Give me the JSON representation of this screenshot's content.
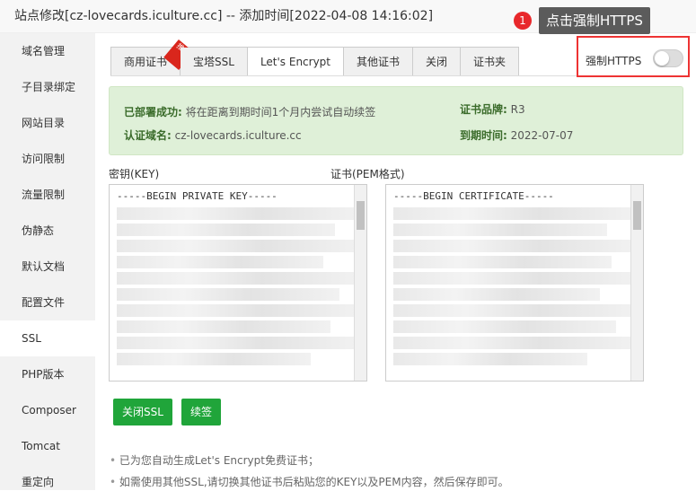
{
  "title": "站点修改[cz-lovecards.iculture.cc] -- 添加时间[2022-04-08 14:16:02]",
  "sidebar": [
    "域名管理",
    "子目录绑定",
    "网站目录",
    "访问限制",
    "流量限制",
    "伪静态",
    "默认文档",
    "配置文件",
    "SSL",
    "PHP版本",
    "Composer",
    "Tomcat",
    "重定向"
  ],
  "tabs": [
    "商用证书",
    "宝塔SSL",
    "Let's Encrypt",
    "其他证书",
    "关闭",
    "证书夹"
  ],
  "ribbon": "推荐",
  "force_https": {
    "label": "强制HTTPS",
    "enabled": false
  },
  "tooltip": {
    "badge": "1",
    "text": "点击强制HTTPS"
  },
  "status": {
    "deployed_label": "已部署成功:",
    "deployed_text": "将在距离到期时间1个月内尝试自动续签",
    "domain_label": "认证域名:",
    "domain": "cz-lovecards.iculture.cc",
    "brand_label": "证书品牌:",
    "brand": "R3",
    "expire_label": "到期时间:",
    "expire": "2022-07-07"
  },
  "key_label": "密钥(KEY)",
  "cert_label": "证书(PEM格式)",
  "key_value": "-----BEGIN PRIVATE KEY-----",
  "cert_value": "-----BEGIN CERTIFICATE-----",
  "buttons": {
    "close_ssl": "关闭SSL",
    "renew": "续签"
  },
  "notes": [
    "已为您自动生成Let's Encrypt免费证书；",
    "如需使用其他SSL,请切换其他证书后粘贴您的KEY以及PEM内容，然后保存即可。"
  ]
}
